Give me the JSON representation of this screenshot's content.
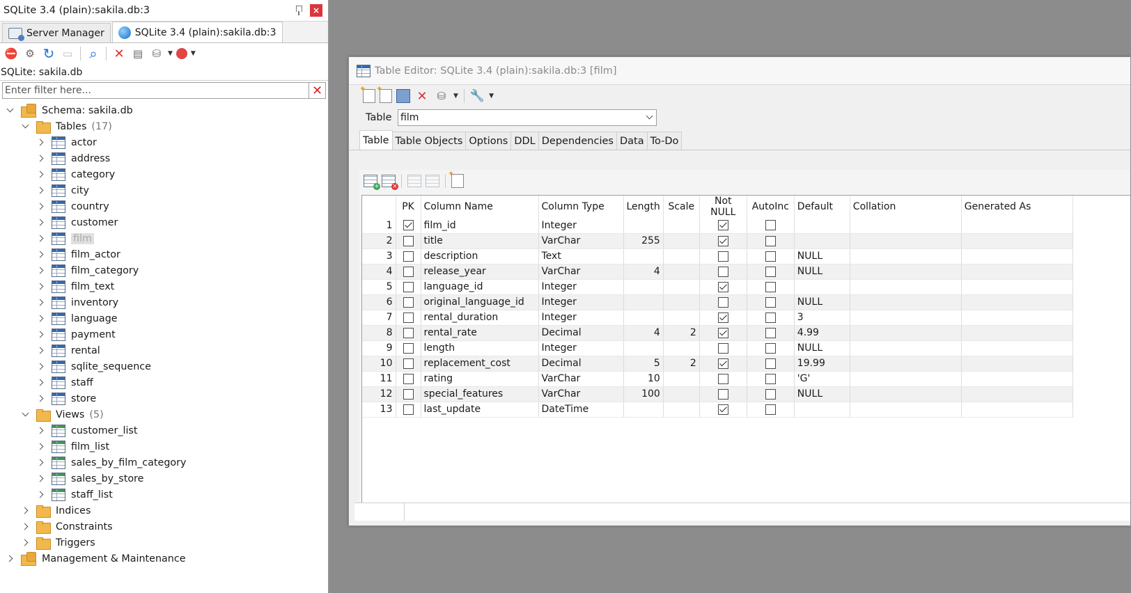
{
  "left_panel": {
    "title": "SQLite 3.4 (plain):sakila.db:3",
    "tabs": [
      {
        "label": "Server Manager"
      },
      {
        "label": "SQLite 3.4 (plain):sakila.db:3"
      }
    ],
    "connection_label": "SQLite: sakila.db",
    "filter": {
      "placeholder": "Enter filter here...",
      "value": ""
    },
    "tree": {
      "schema": "Schema: sakila.db",
      "tables_label": "Tables",
      "tables_count": "(17)",
      "tables": [
        "actor",
        "address",
        "category",
        "city",
        "country",
        "customer",
        "film",
        "film_actor",
        "film_category",
        "film_text",
        "inventory",
        "language",
        "payment",
        "rental",
        "sqlite_sequence",
        "staff",
        "store"
      ],
      "views_label": "Views",
      "views_count": "(5)",
      "views": [
        "customer_list",
        "film_list",
        "sales_by_film_category",
        "sales_by_store",
        "staff_list"
      ],
      "indices": "Indices",
      "constraints": "Constraints",
      "triggers": "Triggers",
      "management": "Management & Maintenance"
    }
  },
  "editor": {
    "title": "Table Editor: SQLite 3.4 (plain):sakila.db:3 [film]",
    "table_label": "Table",
    "table_value": "film",
    "tabs": [
      "Table",
      "Table Objects",
      "Options",
      "DDL",
      "Dependencies",
      "Data",
      "To-Do"
    ],
    "grid": {
      "headers": [
        "",
        "PK",
        "Column Name",
        "Column Type",
        "Length",
        "Scale",
        "Not NULL",
        "AutoInc",
        "Default",
        "Collation",
        "Generated As"
      ],
      "rows": [
        {
          "n": "1",
          "pk": true,
          "name": "film_id",
          "type": "Integer",
          "length": "",
          "scale": "",
          "notnull": true,
          "autoinc": false,
          "default": ""
        },
        {
          "n": "2",
          "pk": false,
          "name": "title",
          "type": "VarChar",
          "length": "255",
          "scale": "",
          "notnull": true,
          "autoinc": false,
          "default": ""
        },
        {
          "n": "3",
          "pk": false,
          "name": "description",
          "type": "Text",
          "length": "",
          "scale": "",
          "notnull": false,
          "autoinc": false,
          "default": "NULL"
        },
        {
          "n": "4",
          "pk": false,
          "name": "release_year",
          "type": "VarChar",
          "length": "4",
          "scale": "",
          "notnull": false,
          "autoinc": false,
          "default": "NULL"
        },
        {
          "n": "5",
          "pk": false,
          "name": "language_id",
          "type": "Integer",
          "length": "",
          "scale": "",
          "notnull": true,
          "autoinc": false,
          "default": ""
        },
        {
          "n": "6",
          "pk": false,
          "name": "original_language_id",
          "type": "Integer",
          "length": "",
          "scale": "",
          "notnull": false,
          "autoinc": false,
          "default": "NULL"
        },
        {
          "n": "7",
          "pk": false,
          "name": "rental_duration",
          "type": "Integer",
          "length": "",
          "scale": "",
          "notnull": true,
          "autoinc": false,
          "default": "3"
        },
        {
          "n": "8",
          "pk": false,
          "name": "rental_rate",
          "type": "Decimal",
          "length": "4",
          "scale": "2",
          "notnull": true,
          "autoinc": false,
          "default": "4.99"
        },
        {
          "n": "9",
          "pk": false,
          "name": "length",
          "type": "Integer",
          "length": "",
          "scale": "",
          "notnull": false,
          "autoinc": false,
          "default": "NULL"
        },
        {
          "n": "10",
          "pk": false,
          "name": "replacement_cost",
          "type": "Decimal",
          "length": "5",
          "scale": "2",
          "notnull": true,
          "autoinc": false,
          "default": "19.99"
        },
        {
          "n": "11",
          "pk": false,
          "name": "rating",
          "type": "VarChar",
          "length": "10",
          "scale": "",
          "notnull": false,
          "autoinc": false,
          "default": "'G'"
        },
        {
          "n": "12",
          "pk": false,
          "name": "special_features",
          "type": "VarChar",
          "length": "100",
          "scale": "",
          "notnull": false,
          "autoinc": false,
          "default": "NULL"
        },
        {
          "n": "13",
          "pk": false,
          "name": "last_update",
          "type": "DateTime",
          "length": "",
          "scale": "",
          "notnull": true,
          "autoinc": false,
          "default": ""
        }
      ]
    }
  },
  "colors": {
    "desktop": "#8c8c8c",
    "accent": "#2d6bb4",
    "close": "#d9363e"
  }
}
